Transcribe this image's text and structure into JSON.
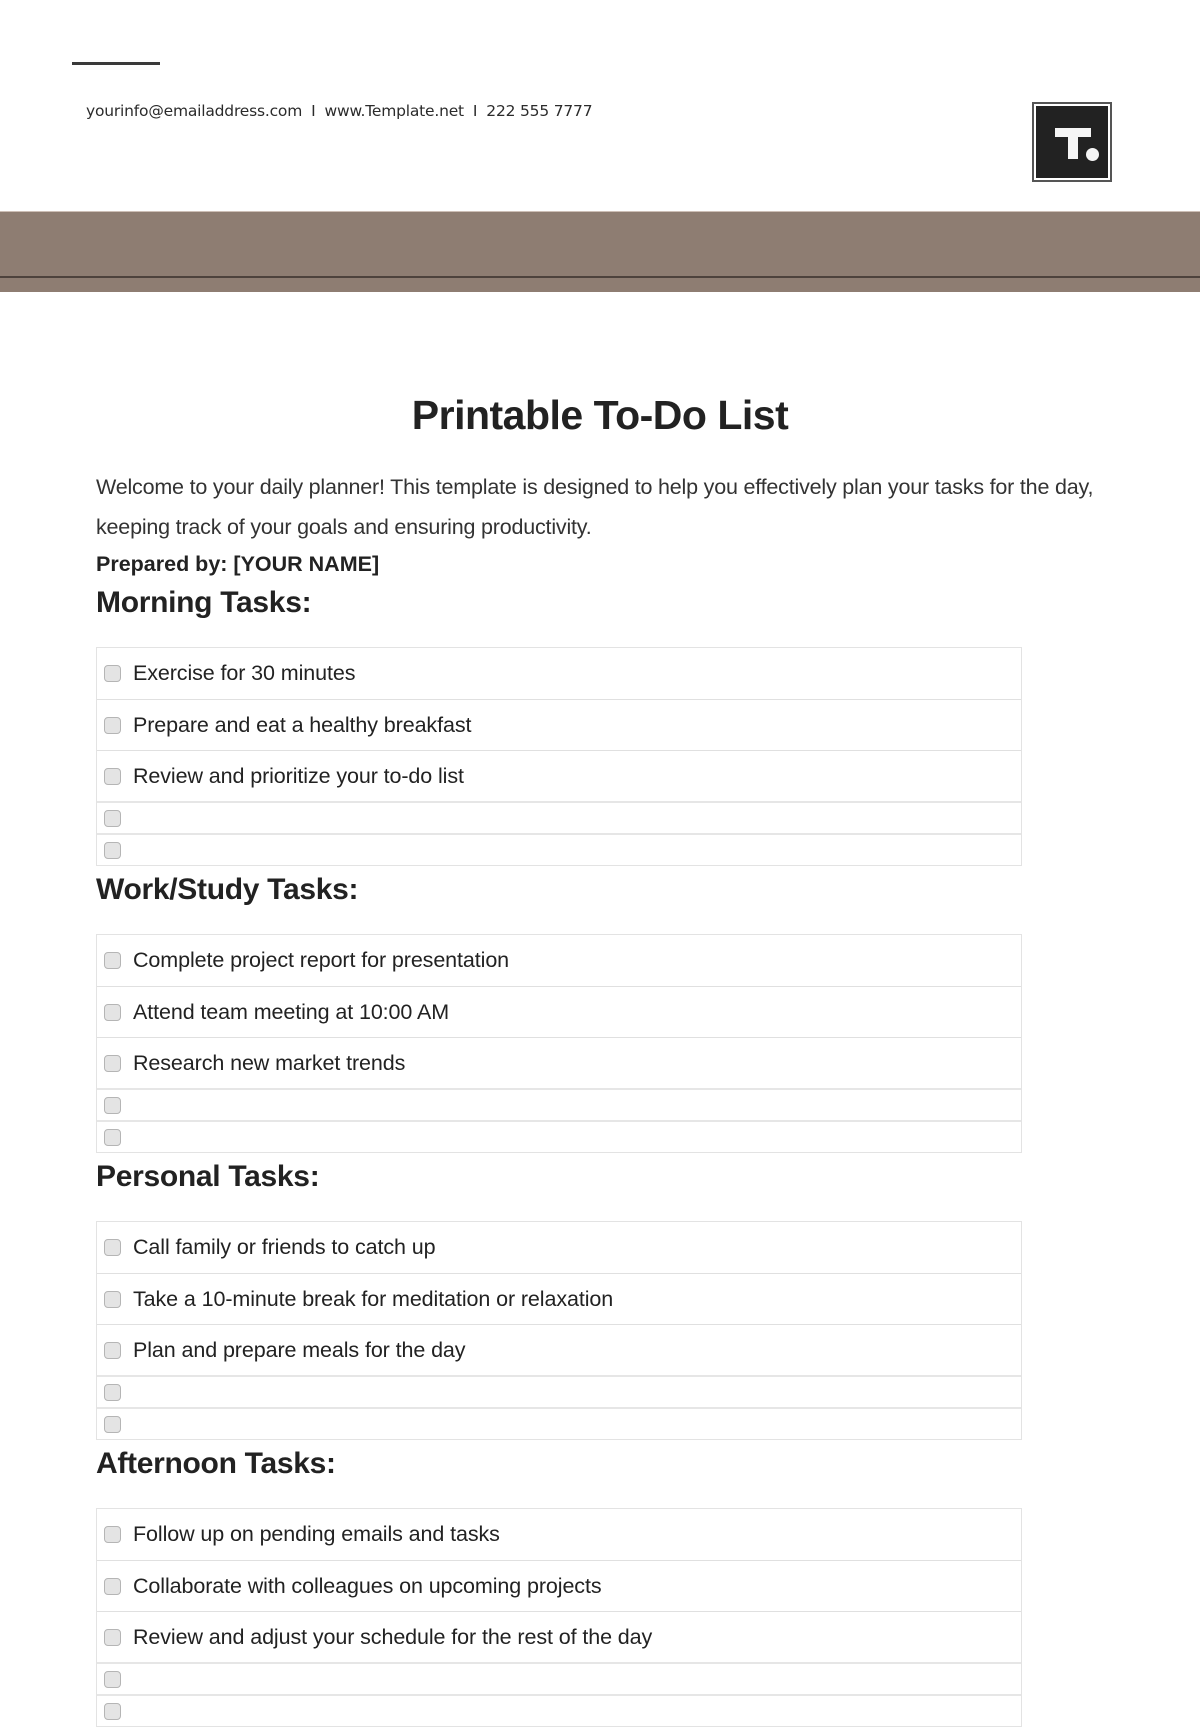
{
  "header": {
    "email": "yourinfo@emailaddress.com",
    "separator": "I",
    "website": "www.Template.net",
    "phone": "222 555 7777",
    "logo_letter": "T",
    "band_color": "#8e7d72"
  },
  "document": {
    "title": "Printable To-Do List",
    "intro": "Welcome to your daily planner! This template is designed to help you effectively plan your tasks for the day, keeping track of your goals and ensuring productivity.",
    "prepared_by": "Prepared by: [YOUR NAME]"
  },
  "sections": [
    {
      "title": "Morning Tasks:",
      "tasks": [
        {
          "label": "Exercise for 30 minutes",
          "checked": false
        },
        {
          "label": "Prepare and eat a healthy breakfast",
          "checked": false
        },
        {
          "label": "Review and prioritize your to-do list",
          "checked": false
        },
        {
          "label": "",
          "checked": false
        },
        {
          "label": "",
          "checked": false
        }
      ]
    },
    {
      "title": "Work/Study Tasks:",
      "tasks": [
        {
          "label": "Complete project report for presentation",
          "checked": false
        },
        {
          "label": "Attend team meeting at 10:00 AM",
          "checked": false
        },
        {
          "label": "Research new market trends",
          "checked": false
        },
        {
          "label": "",
          "checked": false
        },
        {
          "label": "",
          "checked": false
        }
      ]
    },
    {
      "title": "Personal Tasks:",
      "tasks": [
        {
          "label": "Call family or friends to catch up",
          "checked": false
        },
        {
          "label": "Take a 10-minute break for meditation or relaxation",
          "checked": false
        },
        {
          "label": "Plan and prepare meals for the day",
          "checked": false
        },
        {
          "label": "",
          "checked": false
        },
        {
          "label": "",
          "checked": false
        }
      ]
    },
    {
      "title": "Afternoon Tasks:",
      "tasks": [
        {
          "label": "Follow up on pending emails and tasks",
          "checked": false
        },
        {
          "label": "Collaborate with colleagues on upcoming projects",
          "checked": false
        },
        {
          "label": "Review and adjust your schedule for the rest of the day",
          "checked": false
        },
        {
          "label": "",
          "checked": false
        },
        {
          "label": "",
          "checked": false
        }
      ]
    }
  ]
}
